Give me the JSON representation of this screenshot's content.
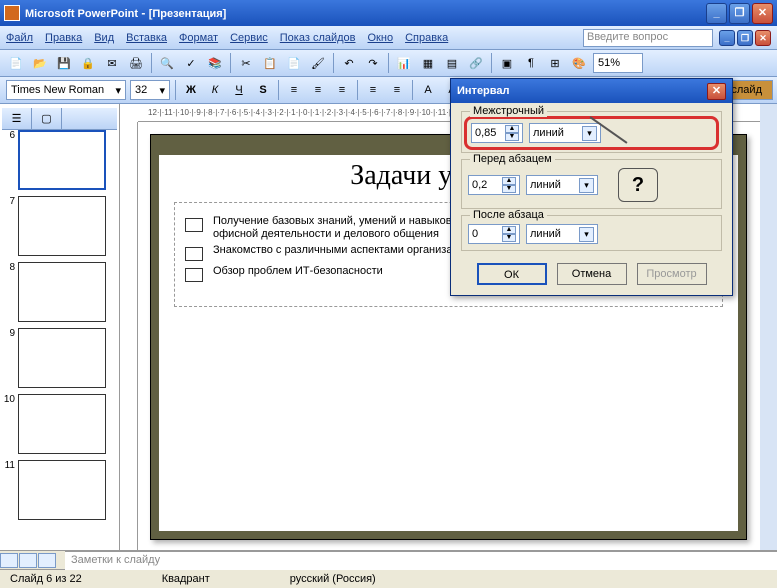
{
  "titlebar": {
    "app": "Microsoft PowerPoint",
    "doc": "[Презентация]"
  },
  "menu": {
    "file": "Файл",
    "edit": "Правка",
    "view": "Вид",
    "insert": "Вставка",
    "format": "Формат",
    "service": "Сервис",
    "slideshow": "Показ слайдов",
    "window": "Окно",
    "help": "Справка",
    "question_placeholder": "Введите вопрос"
  },
  "toolbar": {
    "zoom": "51%"
  },
  "format": {
    "font": "Times New Roman",
    "size": "32"
  },
  "thumbs": {
    "labels": [
      "6",
      "7",
      "8",
      "9",
      "10",
      "11"
    ]
  },
  "slide": {
    "title": "Задачи учебного",
    "bullets": [
      "Получение базовых знаний, умений и навыков по информационным технологиям, основам офисной деятельности и делового общения",
      "Знакомство с различными аспектами организации офисной деятельности",
      "Обзор проблем ИТ-безопасности"
    ]
  },
  "dialog": {
    "title": "Интервал",
    "line_spacing_label": "Межстрочный",
    "before_label": "Перед абзацем",
    "after_label": "После абзаца",
    "line_value": "0,85",
    "line_unit": "линий",
    "before_value": "0,2",
    "before_unit": "линий",
    "after_value": "0",
    "after_unit": "линий",
    "ok": "ОК",
    "cancel": "Отмена",
    "preview": "Просмотр",
    "callout": "?"
  },
  "notes_placeholder": "Заметки к слайду",
  "status": {
    "slide": "Слайд 6 из 22",
    "mode": "Квадрант",
    "lang": "русский (Россия)"
  },
  "sidebtn": "слайд"
}
